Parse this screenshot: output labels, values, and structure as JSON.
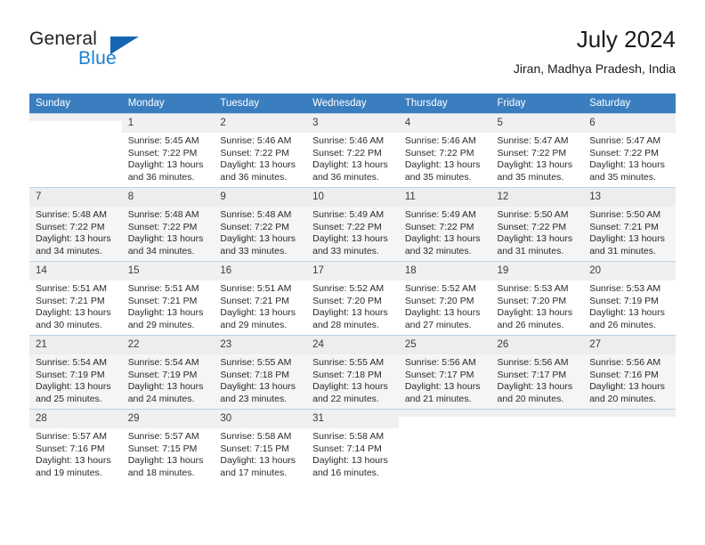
{
  "brand": {
    "name_part1": "General",
    "name_part2": "Blue",
    "triangle_icon": "triangle-icon"
  },
  "header": {
    "title": "July 2024",
    "subtitle": "Jiran, Madhya Pradesh, India"
  },
  "calendar": {
    "weekday_headers": [
      "Sunday",
      "Monday",
      "Tuesday",
      "Wednesday",
      "Thursday",
      "Friday",
      "Saturday"
    ],
    "accent_color": "#3b7ebf",
    "weeks": [
      [
        {
          "day": "",
          "sunrise": "",
          "sunset": "",
          "daylight1": "",
          "daylight2": ""
        },
        {
          "day": "1",
          "sunrise": "Sunrise: 5:45 AM",
          "sunset": "Sunset: 7:22 PM",
          "daylight1": "Daylight: 13 hours",
          "daylight2": "and 36 minutes."
        },
        {
          "day": "2",
          "sunrise": "Sunrise: 5:46 AM",
          "sunset": "Sunset: 7:22 PM",
          "daylight1": "Daylight: 13 hours",
          "daylight2": "and 36 minutes."
        },
        {
          "day": "3",
          "sunrise": "Sunrise: 5:46 AM",
          "sunset": "Sunset: 7:22 PM",
          "daylight1": "Daylight: 13 hours",
          "daylight2": "and 36 minutes."
        },
        {
          "day": "4",
          "sunrise": "Sunrise: 5:46 AM",
          "sunset": "Sunset: 7:22 PM",
          "daylight1": "Daylight: 13 hours",
          "daylight2": "and 35 minutes."
        },
        {
          "day": "5",
          "sunrise": "Sunrise: 5:47 AM",
          "sunset": "Sunset: 7:22 PM",
          "daylight1": "Daylight: 13 hours",
          "daylight2": "and 35 minutes."
        },
        {
          "day": "6",
          "sunrise": "Sunrise: 5:47 AM",
          "sunset": "Sunset: 7:22 PM",
          "daylight1": "Daylight: 13 hours",
          "daylight2": "and 35 minutes."
        }
      ],
      [
        {
          "day": "7",
          "sunrise": "Sunrise: 5:48 AM",
          "sunset": "Sunset: 7:22 PM",
          "daylight1": "Daylight: 13 hours",
          "daylight2": "and 34 minutes."
        },
        {
          "day": "8",
          "sunrise": "Sunrise: 5:48 AM",
          "sunset": "Sunset: 7:22 PM",
          "daylight1": "Daylight: 13 hours",
          "daylight2": "and 34 minutes."
        },
        {
          "day": "9",
          "sunrise": "Sunrise: 5:48 AM",
          "sunset": "Sunset: 7:22 PM",
          "daylight1": "Daylight: 13 hours",
          "daylight2": "and 33 minutes."
        },
        {
          "day": "10",
          "sunrise": "Sunrise: 5:49 AM",
          "sunset": "Sunset: 7:22 PM",
          "daylight1": "Daylight: 13 hours",
          "daylight2": "and 33 minutes."
        },
        {
          "day": "11",
          "sunrise": "Sunrise: 5:49 AM",
          "sunset": "Sunset: 7:22 PM",
          "daylight1": "Daylight: 13 hours",
          "daylight2": "and 32 minutes."
        },
        {
          "day": "12",
          "sunrise": "Sunrise: 5:50 AM",
          "sunset": "Sunset: 7:22 PM",
          "daylight1": "Daylight: 13 hours",
          "daylight2": "and 31 minutes."
        },
        {
          "day": "13",
          "sunrise": "Sunrise: 5:50 AM",
          "sunset": "Sunset: 7:21 PM",
          "daylight1": "Daylight: 13 hours",
          "daylight2": "and 31 minutes."
        }
      ],
      [
        {
          "day": "14",
          "sunrise": "Sunrise: 5:51 AM",
          "sunset": "Sunset: 7:21 PM",
          "daylight1": "Daylight: 13 hours",
          "daylight2": "and 30 minutes."
        },
        {
          "day": "15",
          "sunrise": "Sunrise: 5:51 AM",
          "sunset": "Sunset: 7:21 PM",
          "daylight1": "Daylight: 13 hours",
          "daylight2": "and 29 minutes."
        },
        {
          "day": "16",
          "sunrise": "Sunrise: 5:51 AM",
          "sunset": "Sunset: 7:21 PM",
          "daylight1": "Daylight: 13 hours",
          "daylight2": "and 29 minutes."
        },
        {
          "day": "17",
          "sunrise": "Sunrise: 5:52 AM",
          "sunset": "Sunset: 7:20 PM",
          "daylight1": "Daylight: 13 hours",
          "daylight2": "and 28 minutes."
        },
        {
          "day": "18",
          "sunrise": "Sunrise: 5:52 AM",
          "sunset": "Sunset: 7:20 PM",
          "daylight1": "Daylight: 13 hours",
          "daylight2": "and 27 minutes."
        },
        {
          "day": "19",
          "sunrise": "Sunrise: 5:53 AM",
          "sunset": "Sunset: 7:20 PM",
          "daylight1": "Daylight: 13 hours",
          "daylight2": "and 26 minutes."
        },
        {
          "day": "20",
          "sunrise": "Sunrise: 5:53 AM",
          "sunset": "Sunset: 7:19 PM",
          "daylight1": "Daylight: 13 hours",
          "daylight2": "and 26 minutes."
        }
      ],
      [
        {
          "day": "21",
          "sunrise": "Sunrise: 5:54 AM",
          "sunset": "Sunset: 7:19 PM",
          "daylight1": "Daylight: 13 hours",
          "daylight2": "and 25 minutes."
        },
        {
          "day": "22",
          "sunrise": "Sunrise: 5:54 AM",
          "sunset": "Sunset: 7:19 PM",
          "daylight1": "Daylight: 13 hours",
          "daylight2": "and 24 minutes."
        },
        {
          "day": "23",
          "sunrise": "Sunrise: 5:55 AM",
          "sunset": "Sunset: 7:18 PM",
          "daylight1": "Daylight: 13 hours",
          "daylight2": "and 23 minutes."
        },
        {
          "day": "24",
          "sunrise": "Sunrise: 5:55 AM",
          "sunset": "Sunset: 7:18 PM",
          "daylight1": "Daylight: 13 hours",
          "daylight2": "and 22 minutes."
        },
        {
          "day": "25",
          "sunrise": "Sunrise: 5:56 AM",
          "sunset": "Sunset: 7:17 PM",
          "daylight1": "Daylight: 13 hours",
          "daylight2": "and 21 minutes."
        },
        {
          "day": "26",
          "sunrise": "Sunrise: 5:56 AM",
          "sunset": "Sunset: 7:17 PM",
          "daylight1": "Daylight: 13 hours",
          "daylight2": "and 20 minutes."
        },
        {
          "day": "27",
          "sunrise": "Sunrise: 5:56 AM",
          "sunset": "Sunset: 7:16 PM",
          "daylight1": "Daylight: 13 hours",
          "daylight2": "and 20 minutes."
        }
      ],
      [
        {
          "day": "28",
          "sunrise": "Sunrise: 5:57 AM",
          "sunset": "Sunset: 7:16 PM",
          "daylight1": "Daylight: 13 hours",
          "daylight2": "and 19 minutes."
        },
        {
          "day": "29",
          "sunrise": "Sunrise: 5:57 AM",
          "sunset": "Sunset: 7:15 PM",
          "daylight1": "Daylight: 13 hours",
          "daylight2": "and 18 minutes."
        },
        {
          "day": "30",
          "sunrise": "Sunrise: 5:58 AM",
          "sunset": "Sunset: 7:15 PM",
          "daylight1": "Daylight: 13 hours",
          "daylight2": "and 17 minutes."
        },
        {
          "day": "31",
          "sunrise": "Sunrise: 5:58 AM",
          "sunset": "Sunset: 7:14 PM",
          "daylight1": "Daylight: 13 hours",
          "daylight2": "and 16 minutes."
        },
        {
          "day": "",
          "sunrise": "",
          "sunset": "",
          "daylight1": "",
          "daylight2": ""
        },
        {
          "day": "",
          "sunrise": "",
          "sunset": "",
          "daylight1": "",
          "daylight2": ""
        },
        {
          "day": "",
          "sunrise": "",
          "sunset": "",
          "daylight1": "",
          "daylight2": ""
        }
      ]
    ]
  }
}
